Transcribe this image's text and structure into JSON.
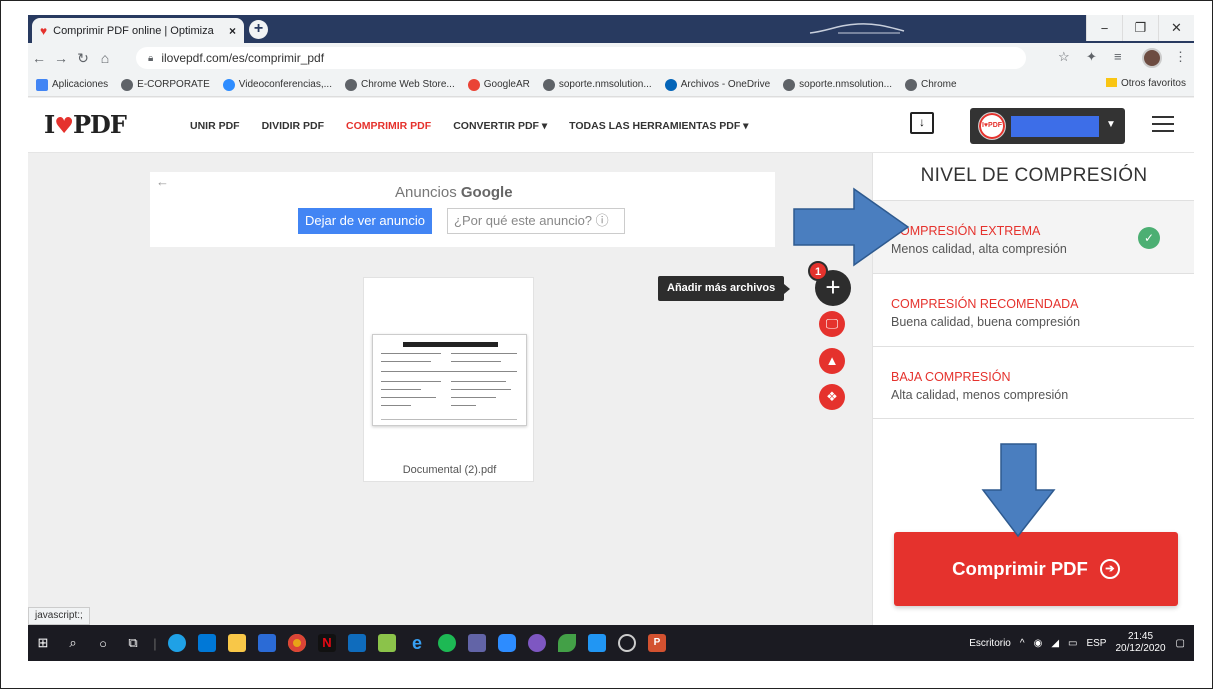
{
  "browser": {
    "tab_title": "Comprimir PDF online | Optimiza",
    "new_tab_symbol": "+",
    "window_buttons": [
      "−",
      "❐",
      "✕"
    ],
    "url": "ilovepdf.com/es/comprimir_pdf",
    "status_text": "javascript:;"
  },
  "bookmarks": {
    "items": [
      {
        "label": "Aplicaciones",
        "color": "#4285f4"
      },
      {
        "label": "E-CORPORATE",
        "color": "#5f6368"
      },
      {
        "label": "Videoconferencias,...",
        "color": "#2d8cff"
      },
      {
        "label": "Chrome Web Store...",
        "color": "#5f6368"
      },
      {
        "label": "GoogleAR",
        "color": "#ea4335"
      },
      {
        "label": "soporte.nmsolution...",
        "color": "#5f6368"
      },
      {
        "label": "Archivos - OneDrive",
        "color": "#0364b8"
      },
      {
        "label": "soporte.nmsolution...",
        "color": "#5f6368"
      },
      {
        "label": "Chrome",
        "color": "#5f6368"
      }
    ],
    "other": "Otros favoritos"
  },
  "site": {
    "logo_left": "I",
    "logo_right": "PDF",
    "nav": [
      "UNIR PDF",
      "DIVIDIR PDF",
      "COMPRIMIR PDF",
      "CONVERTIR PDF ▾",
      "TODAS LAS HERRAMIENTAS PDF ▾"
    ],
    "user_badge": "I♥PDF"
  },
  "ad": {
    "back": "←",
    "title_prefix": "Anuncios",
    "title_brand": "Google",
    "stop_label": "Dejar de ver anuncio",
    "why_label": "¿Por qué este anuncio? ⓘ"
  },
  "file": {
    "name": "Documental (2).pdf"
  },
  "upload": {
    "tooltip": "Añadir más archivos",
    "count": "1"
  },
  "panel": {
    "title": "NIVEL DE COMPRESIÓN",
    "options": [
      {
        "title": "COMPRESIÓN EXTREMA",
        "subtitle": "Menos calidad, alta compresión"
      },
      {
        "title": "COMPRESIÓN RECOMENDADA",
        "subtitle": "Buena calidad, buena compresión"
      },
      {
        "title": "BAJA COMPRESIÓN",
        "subtitle": "Alta calidad, menos compresión"
      }
    ],
    "button_label": "Comprimir PDF"
  },
  "taskbar": {
    "desktop_label": "Escritorio",
    "lang": "ESP",
    "time": "21:45",
    "date": "20/12/2020"
  },
  "colors": {
    "brand_red": "#e5322d",
    "check_green": "#4caf73",
    "annotation_arrow": "#4a7ebf",
    "ad_blue": "#4285f4"
  }
}
